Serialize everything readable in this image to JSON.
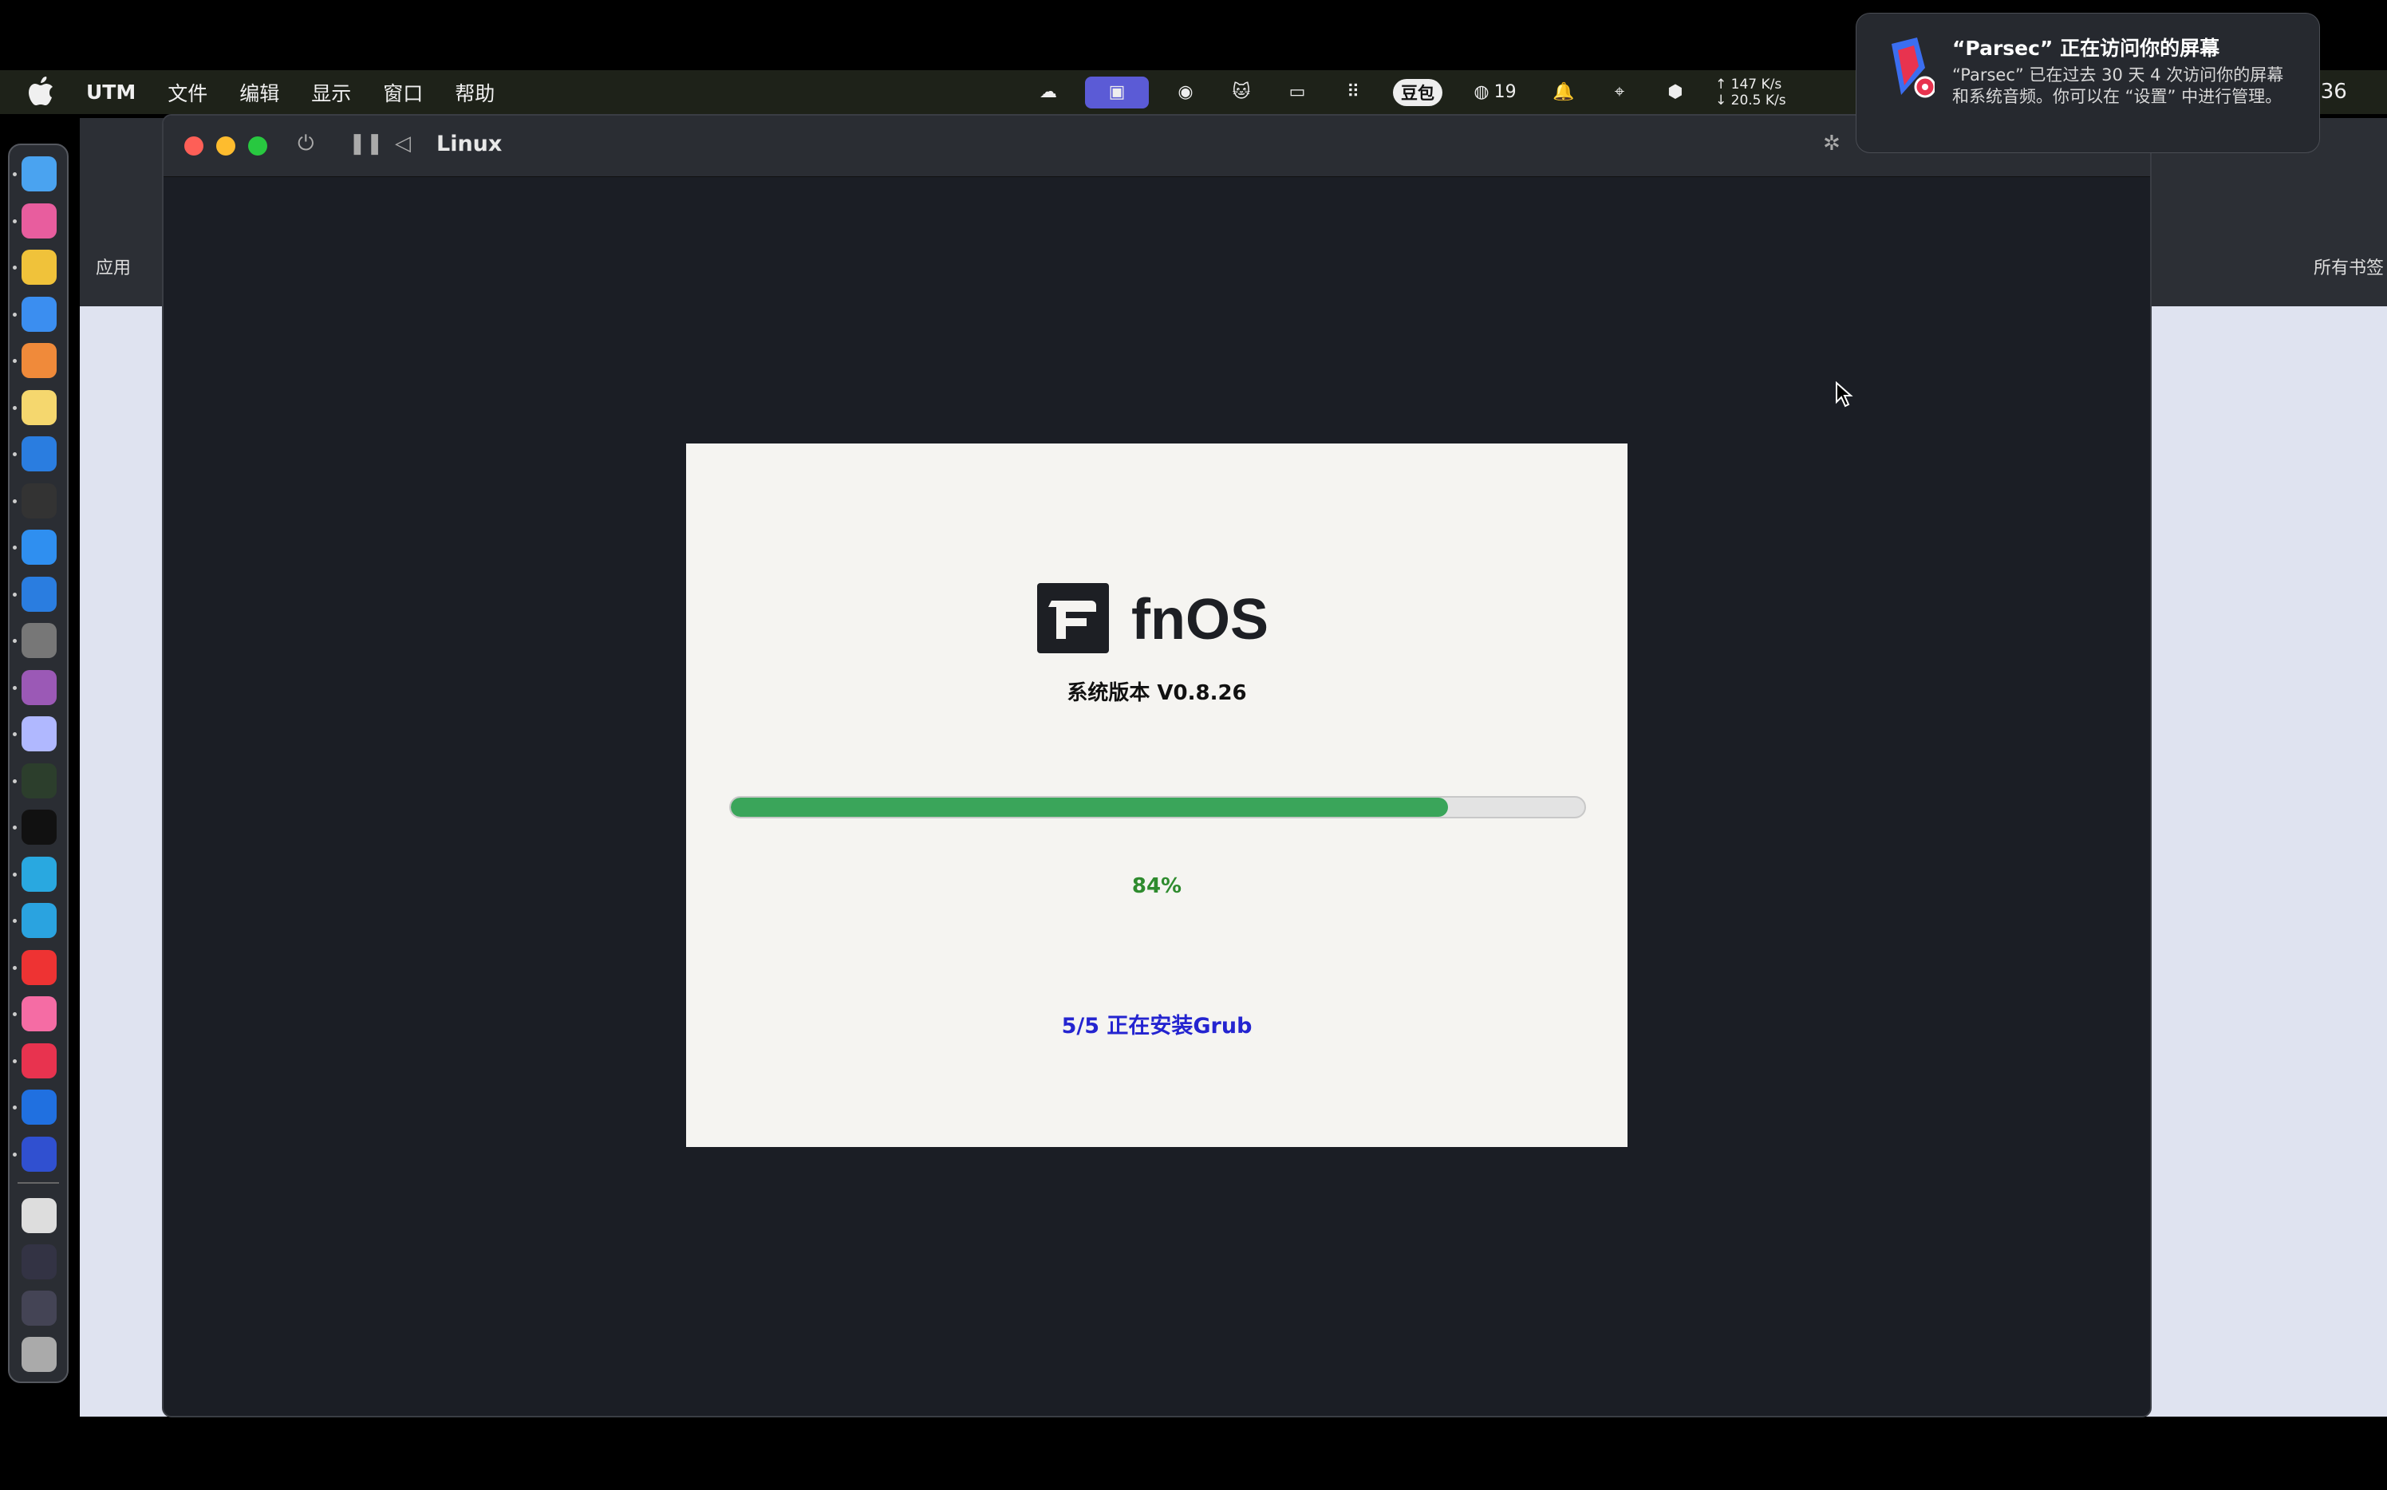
{
  "menubar": {
    "app_name": "UTM",
    "items": [
      "文件",
      "编辑",
      "显示",
      "窗口",
      "帮助"
    ],
    "tray_badge_label": "豆包",
    "tray_count": "19",
    "net_up": "↑ 147 K/s",
    "net_down": "↓ 20.5 K/s",
    "clock_fragment": ":36"
  },
  "browser": {
    "bookmarks_label": "所有书签",
    "apps_label": "应用"
  },
  "window": {
    "title": "Linux"
  },
  "installer": {
    "logo_text": "fnOS",
    "version_label": "系统版本 V0.8.26",
    "progress_percent": 84,
    "percent_label": "84%",
    "step_label": "5/5 正在安装Grub"
  },
  "notification": {
    "title": "“Parsec” 正在访问你的屏幕",
    "body": "“Parsec” 已在过去 30 天 4 次访问你的屏幕和系统音频。你可以在 “设置” 中进行管理。"
  },
  "colors": {
    "progress_fill": "#3aa55a",
    "percent_text": "#2e8b2e",
    "step_text": "#2424d0"
  },
  "dock_icons": [
    "finder-icon",
    "launchpad-icon",
    "chrome-icon",
    "safari-icon",
    "photos-icon",
    "notes-icon",
    "vscode-icon",
    "terminal-icon",
    "appstore-icon",
    "network-icon",
    "settings-icon",
    "podcast-icon",
    "avatar-icon",
    "activity-icon",
    "qq-icon",
    "lark-icon",
    "telegram-icon",
    "netease-music-icon",
    "cloud-icon",
    "parsec-icon",
    "teamviewer-icon",
    "remote-icon",
    "document-icon",
    "window-thumb-icon",
    "window-thumb2-icon",
    "trash-icon"
  ]
}
